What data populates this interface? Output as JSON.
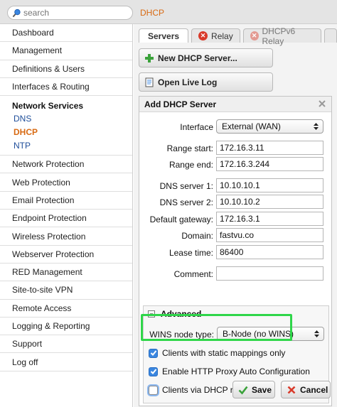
{
  "search": {
    "placeholder": "search"
  },
  "breadcrumb": "DHCP",
  "sidebar": {
    "items_top": [
      "Dashboard",
      "Management",
      "Definitions & Users",
      "Interfaces & Routing"
    ],
    "group": {
      "title": "Network Services",
      "subs": [
        "DNS",
        "DHCP",
        "NTP"
      ],
      "active": "DHCP"
    },
    "items_bottom": [
      "Network Protection",
      "Web Protection",
      "Email Protection",
      "Endpoint Protection",
      "Wireless Protection",
      "Webserver Protection",
      "RED Management",
      "Site-to-site VPN",
      "Remote Access",
      "Logging & Reporting",
      "Support",
      "Log off"
    ]
  },
  "tabs": [
    "Servers",
    "Relay",
    "DHCPv6 Relay"
  ],
  "buttons": {
    "new_server": "New DHCP Server...",
    "live_log": "Open Live Log",
    "save": "Save",
    "cancel": "Cancel"
  },
  "form": {
    "title": "Add DHCP Server",
    "interface": {
      "label": "Interface",
      "value": "External (WAN)"
    },
    "range_start": {
      "label": "Range start:",
      "value": "172.16.3.11"
    },
    "range_end": {
      "label": "Range end:",
      "value": "172.16.3.244"
    },
    "dns1": {
      "label": "DNS server 1:",
      "value": "10.10.10.1"
    },
    "dns2": {
      "label": "DNS server 2:",
      "value": "10.10.10.2"
    },
    "gateway": {
      "label": "Default gateway:",
      "value": "172.16.3.1"
    },
    "domain": {
      "label": "Domain:",
      "value": "fastvu.co"
    },
    "lease": {
      "label": "Lease time:",
      "value": "86400"
    },
    "comment": {
      "label": "Comment:",
      "value": ""
    },
    "advanced": {
      "title": "Advanced",
      "wins": {
        "label": "WINS node type:",
        "value": "B-Node (no WINS)"
      },
      "static_mappings": {
        "label": "Clients with static mappings only",
        "checked": true
      },
      "http_proxy": {
        "label": "Enable HTTP Proxy Auto Configuration",
        "checked": true
      },
      "relay_agent": {
        "label": "Clients via DHCP relay agent",
        "checked": false
      }
    }
  },
  "colors": {
    "accent": "#d86a13",
    "link": "#1f4e9a",
    "highlight": "#2fd64a",
    "checkbox": "#3a86e0"
  }
}
